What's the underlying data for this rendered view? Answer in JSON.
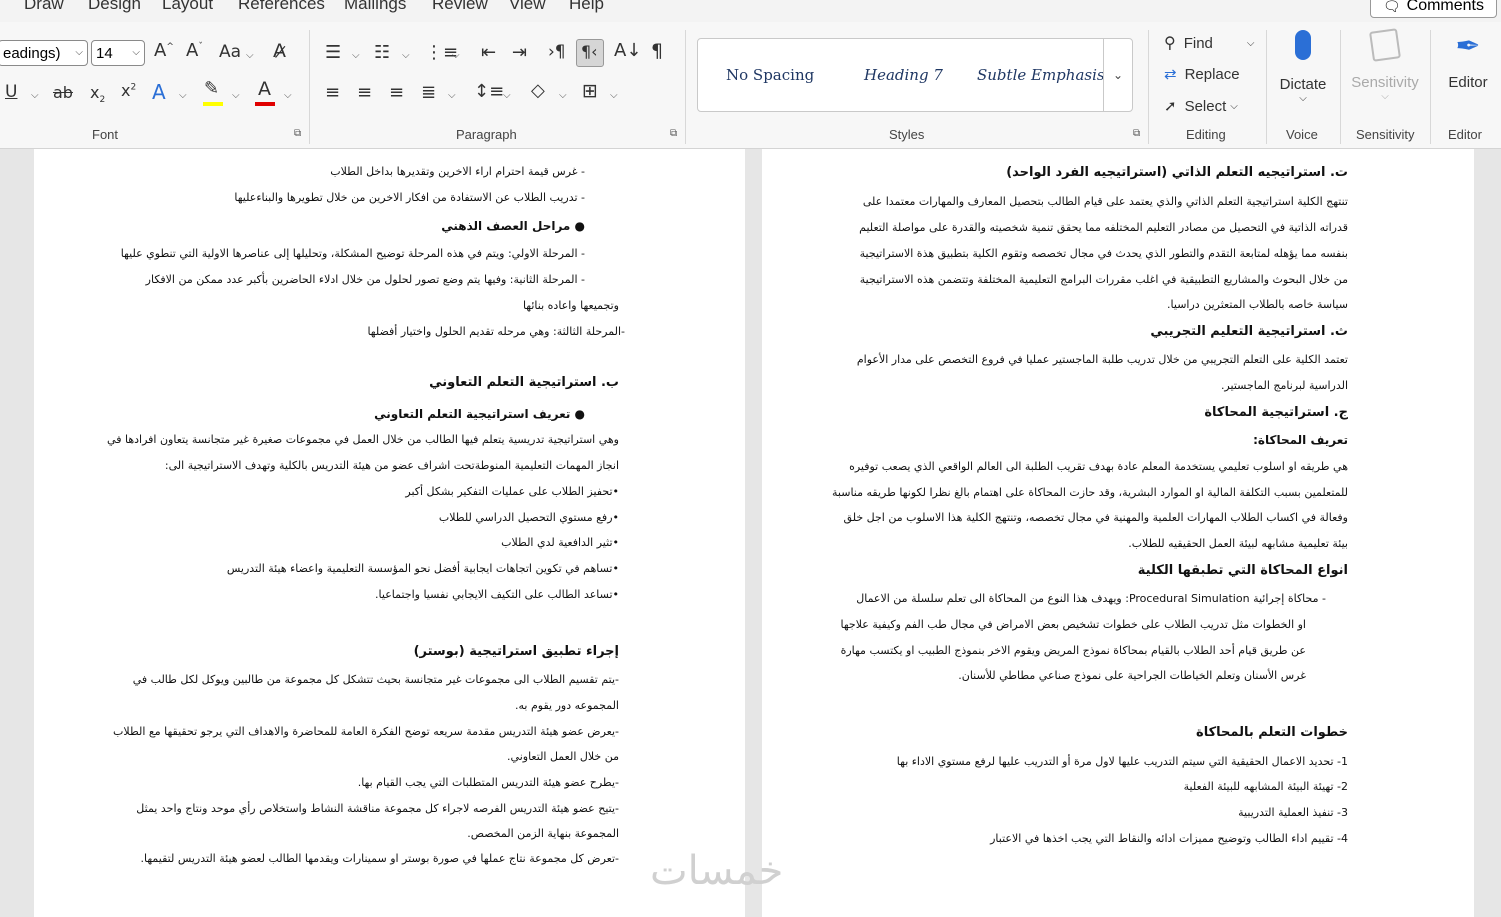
{
  "menu": {
    "tabs": [
      "Draw",
      "Design",
      "Layout",
      "References",
      "Mailings",
      "Review",
      "View",
      "Help"
    ],
    "comments": "Comments"
  },
  "font_group": {
    "style_combo": "eadings)",
    "size": "14",
    "label": "Font"
  },
  "paragraph_group": {
    "label": "Paragraph"
  },
  "styles_group": {
    "items": [
      "No Spacing",
      "Heading 7",
      "Subtle Emphasis"
    ],
    "label": "Styles"
  },
  "editing_group": {
    "find": "Find",
    "replace": "Replace",
    "select": "Select",
    "label": "Editing"
  },
  "voice_group": {
    "dictate": "Dictate",
    "label": "Voice"
  },
  "sensitivity_group": {
    "button": "Sensitivity",
    "label": "Sensitivity"
  },
  "editor_group": {
    "button": "Editor",
    "label": "Editor"
  },
  "colors": {
    "highlight": "#ffff00",
    "font_color": "#e00000",
    "text_effect": "#2b6fd6"
  },
  "left_page": [
    "-    غرس قيمة احترام اراء الاخرين وتقديرها بداخل الطلاب",
    "-    تدريب الطلاب عن الاستفادة من افكار الاخرين من خلال تطويرها والبناءعليها",
    "●    مراحل العصف الذهني",
    "-    المرحلة الاولي: ويتم في هذه المرحلة توضيح المشكلة، وتحليلها إلى عناصرها الاولية التي تنطوي عليها",
    "-    المرحلة الثانية: وفيها يتم وضع تصور لحلول من خلال ادلاء الحاضرين بأكبر عدد ممكن من الافكار",
    "وتجميعها واعاده بنائها",
    "-المرحلة الثالثة: وهي مرحله تقديم الحلول واختيار أفضلها",
    "ب. استراتيجية التعلم التعاوني",
    "●    تعريف استراتيجية التعلم التعاوني",
    "وهي استراتيجية تدريسية يتعلم فيها الطالب من خلال العمل في مجموعات صغيرة غير متجانسة يتعاون افرادها في",
    "انجاز المهمات التعليمية المنوطةتحت اشراف عضو من هيئة التدريس بالكلية وتهدف الاستراتيجية الى:",
    "•تحفيز الطلاب على عمليات التفكير بشكل أكبر",
    "•رفع مستوي التحصيل الدراسي للطلاب",
    "•تثير الدافعية لدي الطلاب",
    "•تساهم في تكوين اتجاهات ايجابية أفضل نحو المؤسسة التعليمية واعضاء هيئة التدريس",
    "•تساعد الطالب على التكيف الايجابي نفسيا واجتماعيا.",
    "إجراء تطبيق استراتيجية (بوستر)",
    "-يتم تقسيم الطلاب الى مجموعات غير متجانسة بحيث تتشكل كل مجموعة من طالبين ويوكل لكل طالب في",
    "المجموعه دور يقوم به.",
    "-يعرض عضو هيئة التدريس مقدمة سريعه توضح الفكرة العامة للمحاضرة والاهداف التي يرجو تحقيقها مع الطلاب",
    "من خلال العمل التعاوني.",
    "-يطرح عضو هيئة التدريس المتطلبات التي يجب القيام بها.",
    "-يتيح عضو هيئة التدريس الفرصه لاجراء كل مجموعة مناقشة النشاط واستخلاص رأي موحد ونتاج واحد يمثل",
    "المجموعة بنهاية الزمن المخصص.",
    "-تعرض كل مجموعة نتاج عملها في صورة بوستر او سمينارات ويقدمها الطالب لعضو هيئة التدريس لتقيمها."
  ],
  "right_page": [
    "ت. استراتيجيه التعلم الذاتي (استراتيجيه الفرد الواحد)",
    "تنتهج الكلية استراتيجية التعلم الذاتي والذي يعتمد على قيام الطالب بتحصيل المعارف والمهارات معتمدا على",
    "قدراته الذاتية في التحصيل من مصادر التعليم المختلفه مما يحقق تنمية شخصيته والقدرة على مواصلة التعليم",
    "بنفسه مما يؤهله لمتابعة التقدم والتطور الذي يحدث في مجال تخصصه وتقوم الكلية بتطبيق هذة الاستراتيجية",
    "من خلال البحوث والمشاريع التطبيقية في اغلب مقررات البرامج التعليمية المختلفة وتتضمن هذه الاستراتيجية",
    "سياسة خاصه بالطلاب المتعثرين دراسيا.",
    "ث. استراتيجية التعليم التجريبي",
    "تعتمد الكلية على التعلم التجريبي من خلال تدريب طلبة الماجستير عمليا في فروع التخصص على مدار الأعوام",
    "الدراسية لبرنامج الماجستير.",
    "ج. استراتيجية المحاكاة",
    "تعريف المحاكاة:",
    "هي طريقه او اسلوب تعليمي يستخدمة المعلم عادة بهدف تقريب الطلبة الى العالم الواقعي الذي يصعب توفيره",
    "للمتعلمين بسبب التكلفة المالية او الموارد البشرية، وقد حازت المحاكاة على اهتمام بالغ نظرا لكونها طريقه مناسبة",
    "وفعالة في اكساب الطلاب المهارات العلمية والمهنية في مجال تخصصه، وتنتهج الكلية هذا الاسلوب من اجل خلق",
    "بيئة تعليمية مشابهه لبيئة العمل الحقيقيه للطلاب.",
    "انواع المحاكاة التي تطبقها الكلية",
    "-    محاكاة إجرائية Procedural Simulation: ويهدف هذا النوع من المحاكاة الى تعلم سلسلة من الاعمال",
    "او الخطوات مثل تدريب الطلاب على خطوات تشخيص بعض الامراض في مجال طب الفم وكيفية علاجها",
    "عن طريق قيام أحد الطلاب بالقيام بمحاكاة نموذج المريض ويقوم الاخر بنموذج الطبيب او يكتسب مهارة",
    "غرس الأسنان وتعلم الخياطات الجراحية على نموذج صناعي مطاطي للأسنان.",
    "خطوات التعلم بالمحاكاة",
    "1- تحديد الاعمال الحقيقية التي سيتم التدريب عليها لاول مرة أو التدريب عليها لرفع مستوي الاداء بها",
    "2- تهيئة البيئة المشابهه للبيئة الفعلية",
    "3- تنفيذ العملية التدريبية",
    "4- تقييم اداء الطالب وتوضيح مميزات ادائه والنقاط التي يجب اخذها في الاعتبار"
  ],
  "watermark": "خمسات"
}
